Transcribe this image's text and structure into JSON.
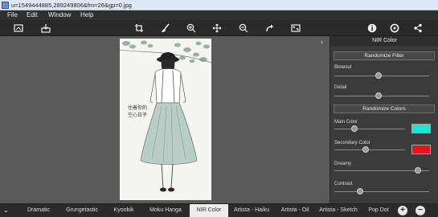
{
  "window": {
    "title": "u=1549444885,289249806&fm=26&gp=0.jpg"
  },
  "menu": [
    "File",
    "Edit",
    "Window",
    "Help"
  ],
  "toolbar": {
    "left_icons": [
      "compare-icon",
      "export-icon"
    ],
    "center_icons": [
      "crop-icon",
      "brush-icon",
      "zoom-in-icon",
      "move-icon",
      "zoom-out-icon",
      "redo-icon",
      "fit-icon"
    ],
    "right_icons": [
      "info-icon",
      "settings-icon",
      "share-icon"
    ]
  },
  "photo": {
    "handwriting": "住着你的\n空心日子"
  },
  "panel": {
    "title": "NIR Color",
    "randomize_filter": "Randomize Filter",
    "blowout_label": "Blowout",
    "blowout_value": 0.47,
    "detail_label": "Detail",
    "detail_value": 0.47,
    "randomize_colors": "Randomize Colors",
    "main_color_label": "Main Color",
    "main_color_value": 0.28,
    "main_color": "#1de4d2",
    "secondary_color_label": "Secondary Color",
    "secondary_color_value": 0.44,
    "secondary_color": "#e8141c",
    "dreamy_label": "Dreamy",
    "dreamy_value": 0.88,
    "contrast_label": "Contrast",
    "contrast_value": 0.27
  },
  "filters": [
    "Dramatic",
    "Grungetastic",
    "Kyoobik",
    "Moku Hanga",
    "NIR Color",
    "Artista - Haiku",
    "Artista - Oil",
    "Artista - Sketch",
    "Pop Dot"
  ],
  "active_filter": "NIR Color",
  "filmstrip": {
    "add": "+",
    "remove": "−"
  }
}
